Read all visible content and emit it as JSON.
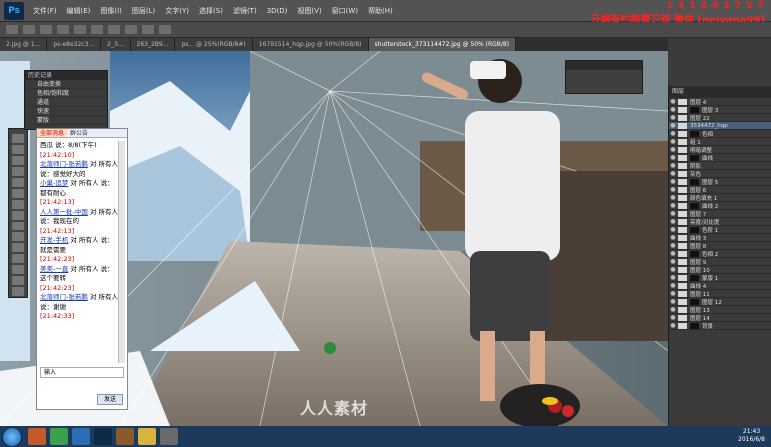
{
  "app": {
    "name": "Ps"
  },
  "menubar": {
    "items": [
      "文件(F)",
      "编辑(E)",
      "图像(I)",
      "图层(L)",
      "文字(Y)",
      "选择(S)",
      "滤镜(T)",
      "3D(D)",
      "视图(V)",
      "窗口(W)",
      "帮助(H)"
    ]
  },
  "overlay": {
    "line1": "1 3 1 2 9 2 7 2 7",
    "line2": "云端有约群暨习观 微信 [neivana99]"
  },
  "doc_tabs": [
    "2.jpg @ 1...",
    "ps-e8e32c3...",
    "2_3...",
    "263_2B9...",
    "ps... @ 25%(RGB/8#)",
    "16791514_hqp.jpg @ 50%(RGB/8)",
    "shutterstock_373114472.jpg @ 50% (RGB/8)"
  ],
  "history_panel": {
    "title": "历史记录",
    "rows": [
      "自由变换",
      "色相/饱和度",
      "通道",
      "快速",
      "蒙版"
    ]
  },
  "chat": {
    "tab_active": "全部消息",
    "tab_other": "群公告",
    "first_line": "西瓜 说：8/8(下午)",
    "first_time": "[21:42:10]",
    "messages": [
      {
        "who": "北落师门-张若鹏",
        "text": "对 所有人 说：感觉好大的",
        "time": ""
      },
      {
        "who": "小巢-追梦",
        "text": "对 所有人 说：都有耐心",
        "time": "[21:42:13]"
      },
      {
        "who": "人人第一批-中国",
        "text": "对 所有人 说：我现在的",
        "time": "[21:42:13]"
      },
      {
        "who": "开发-手机",
        "text": "对 所有人 说：就是需要",
        "time": "[21:42:23]"
      },
      {
        "who": "美美-一直",
        "text": "对 所有人 说：这个要转",
        "time": "[21:42:23]"
      },
      {
        "who": "北落师门-张若鹏",
        "text": "对 所有人 说：谢谢",
        "time": "[21:42:33]"
      }
    ],
    "input_placeholder": "输入",
    "send": "发送"
  },
  "layers_panel": {
    "title": "图层",
    "rows": [
      "图层 4",
      "图层 3",
      "图层 22",
      "3534472_hqp",
      "色相",
      "组 1",
      "明暗调整",
      "曲线",
      "阴影",
      "灰色",
      "图层 5",
      "图层 6",
      "颜色填充 1",
      "曲线 2",
      "图层 7",
      "亮度/对比度",
      "色阶 1",
      "曲线 3",
      "图层 8",
      "色相 2",
      "图层 9",
      "图层 10",
      "蒙版 1",
      "曲线 4",
      "图层 11",
      "图层 12",
      "图层 13",
      "图层 14",
      "背景"
    ]
  },
  "taskbar": {
    "clock_time": "21:43",
    "clock_date": "2016/6/8"
  },
  "watermark": "人人素材"
}
